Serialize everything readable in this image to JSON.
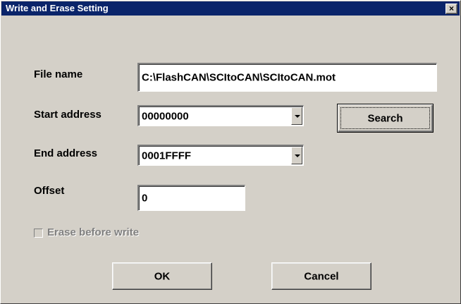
{
  "window": {
    "title": "Write and Erase Setting",
    "close_glyph": "×"
  },
  "form": {
    "file_name_label": "File name",
    "file_name_value": "C:\\FlashCAN\\SCItoCAN\\SCItoCAN.mot",
    "start_address_label": "Start address",
    "start_address_value": "00000000",
    "end_address_label": "End address",
    "end_address_value": "0001FFFF",
    "offset_label": "Offset",
    "offset_value": "0",
    "erase_label": "Erase before write",
    "erase_checked": false,
    "erase_enabled": false
  },
  "buttons": {
    "search": "Search",
    "ok": "OK",
    "cancel": "Cancel"
  },
  "icons": {
    "close": "close-icon",
    "dropdown": "chevron-down-icon"
  }
}
